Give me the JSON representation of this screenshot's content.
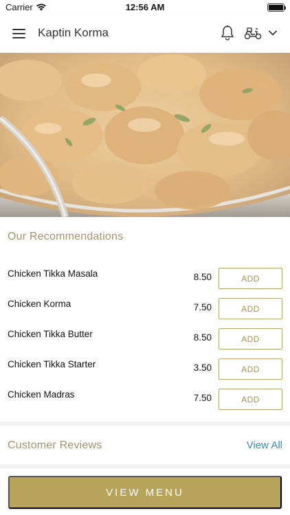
{
  "status_bar": {
    "carrier": "Carrier",
    "time": "12:56 AM"
  },
  "nav": {
    "title": "Kaptin Korma",
    "icons": [
      "menu-icon",
      "bell-icon",
      "scooter-icon",
      "chevron-down-icon"
    ]
  },
  "recommendations": {
    "title": "Our Recommendations",
    "items": [
      {
        "name": "Chicken Tikka Masala",
        "price": "8.50",
        "add_label": "ADD"
      },
      {
        "name": "Chicken Korma",
        "price": "7.50",
        "add_label": "ADD"
      },
      {
        "name": "Chicken Tikka Butter",
        "price": "8.50",
        "add_label": "ADD"
      },
      {
        "name": "Chicken Tikka Starter",
        "price": "3.50",
        "add_label": "ADD"
      },
      {
        "name": "Chicken Madras",
        "price": "7.50",
        "add_label": "ADD"
      }
    ]
  },
  "reviews": {
    "title": "Customer Reviews",
    "view_all_label": "View All"
  },
  "bottom": {
    "view_menu_label": "VIEW MENU"
  },
  "colors": {
    "accent_gold": "#b8a35a",
    "section_title": "#a39272",
    "link_blue": "#3a8fb5"
  }
}
